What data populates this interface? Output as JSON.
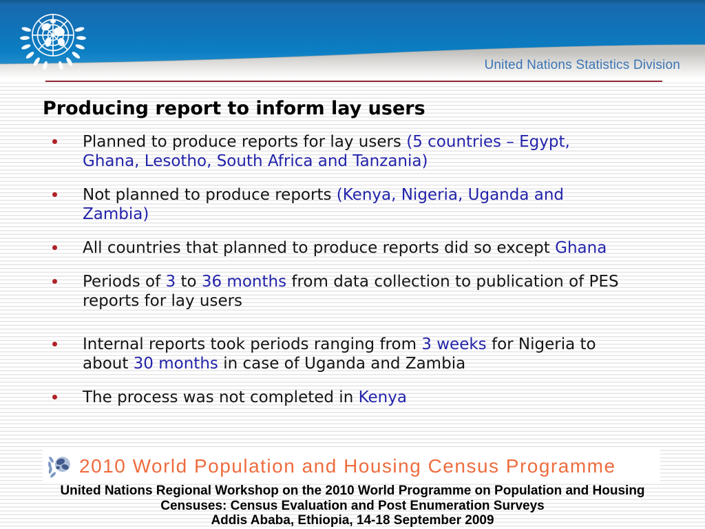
{
  "colors": {
    "accent-blue": "#2323aa",
    "bullet-red": "#b02227",
    "divider-maroon": "#8e2333",
    "division-blue": "#3b74b4",
    "programme-orange": "#ee6c3e"
  },
  "header": {
    "division_label": "United Nations Statistics Division"
  },
  "slide": {
    "title": "Producing report to inform lay users",
    "bullets": [
      {
        "lines": [
          [
            {
              "t": "Planned to produce reports for lay users ",
              "c": "ink"
            },
            {
              "t": "(5 countries – Egypt,",
              "c": "blue"
            }
          ],
          [
            {
              "t": "Ghana, Lesotho, South Africa and Tanzania)",
              "c": "blue"
            }
          ]
        ]
      },
      {
        "lines": [
          [
            {
              "t": "Not planned to produce reports ",
              "c": "ink"
            },
            {
              "t": "(Kenya, Nigeria, Uganda and",
              "c": "blue"
            }
          ],
          [
            {
              "t": "Zambia)",
              "c": "blue"
            }
          ]
        ]
      },
      {
        "lines": [
          [
            {
              "t": "All countries that planned to produce reports did so except ",
              "c": "ink"
            },
            {
              "t": "Ghana",
              "c": "blue"
            }
          ]
        ]
      },
      {
        "lines": [
          [
            {
              "t": "Periods of ",
              "c": "ink"
            },
            {
              "t": "3",
              "c": "blue"
            },
            {
              "t": " to ",
              "c": "ink"
            },
            {
              "t": "36 months",
              "c": "blue"
            },
            {
              "t": " from data collection to publication of PES",
              "c": "ink"
            }
          ],
          [
            {
              "t": "reports for lay users",
              "c": "ink"
            }
          ]
        ]
      },
      {
        "lines": [
          [
            {
              "t": "Internal reports took periods ranging from ",
              "c": "ink"
            },
            {
              "t": "3 weeks",
              "c": "blue"
            },
            {
              "t": " for Nigeria to",
              "c": "ink"
            }
          ],
          [
            {
              "t": "about ",
              "c": "ink"
            },
            {
              "t": "30 months",
              "c": "blue"
            },
            {
              "t": " in case of Uganda and Zambia",
              "c": "ink"
            }
          ]
        ]
      },
      {
        "lines": [
          [
            {
              "t": "The process was not completed in ",
              "c": "ink"
            },
            {
              "t": "Kenya",
              "c": "blue"
            }
          ]
        ]
      }
    ]
  },
  "footer": {
    "programme_logo_text": "2010 World Population and Housing Census Programme",
    "lines": [
      "United Nations Regional Workshop on the 2010 World Programme on Population and Housing",
      "Censuses: Census Evaluation and Post Enumeration Surveys",
      "Addis Ababa, Ethiopia, 14-18 September 2009"
    ]
  }
}
